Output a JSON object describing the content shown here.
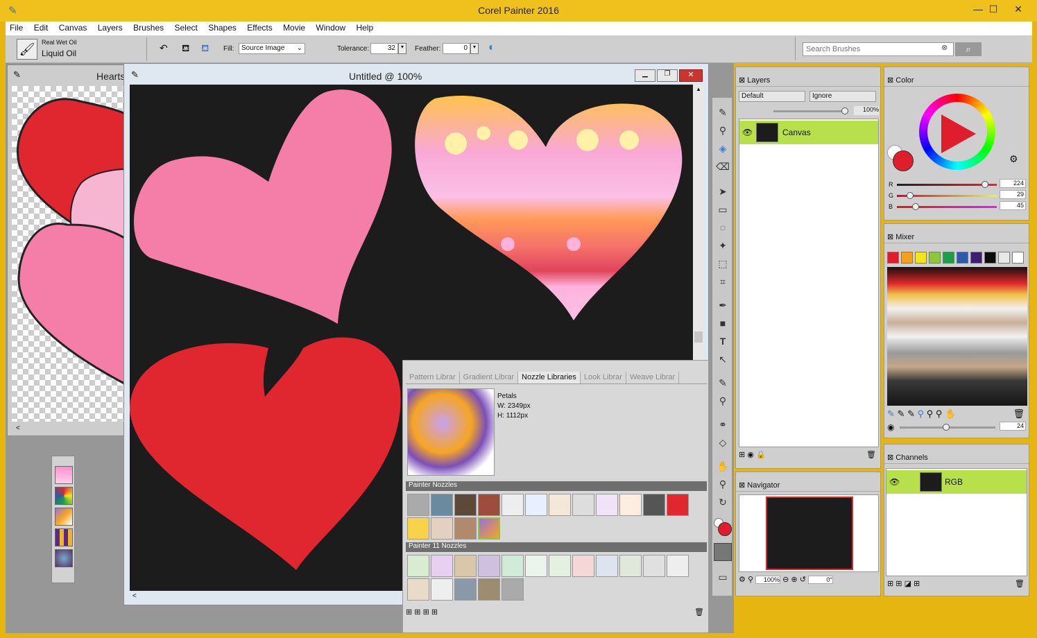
{
  "app": {
    "title": "Corel Painter 2016",
    "min": "—",
    "max": "☐",
    "close": "✕"
  },
  "menu": [
    "File",
    "Edit",
    "Canvas",
    "Layers",
    "Brushes",
    "Select",
    "Shapes",
    "Effects",
    "Movie",
    "Window",
    "Help"
  ],
  "brush": {
    "category": "Real Wet Oil",
    "variant": "Liquid Oil"
  },
  "toolbar": {
    "fill_label": "Fill:",
    "fill_value": "Source Image",
    "tolerance_label": "Tolerance:",
    "tolerance_value": "32",
    "feather_label": "Feather:",
    "feather_value": "0",
    "search_placeholder": "Search Brushes"
  },
  "docs": {
    "back_title": "Hearts",
    "front_title": "Untitled @ 100%"
  },
  "layers": {
    "title": "Layers",
    "composite": "Default",
    "method": "Ignore",
    "opacity": "100%",
    "items": [
      {
        "name": "Canvas"
      }
    ]
  },
  "navigator": {
    "title": "Navigator",
    "zoom": "100%",
    "rotation": "0°"
  },
  "color": {
    "title": "Color",
    "r_label": "R",
    "g_label": "G",
    "b_label": "B",
    "r": "224",
    "g": "29",
    "b": "45",
    "main": "#e01d2d"
  },
  "mixer": {
    "title": "Mixer",
    "brush_size": "24",
    "swatches": [
      "#e01d2d",
      "#f2a11a",
      "#f4e51a",
      "#8dc63f",
      "#1e9e4a",
      "#2e5aa8",
      "#3b2070",
      "#0c0c0c",
      "#e8e8e8",
      "#ffffff"
    ]
  },
  "channels": {
    "title": "Channels",
    "items": [
      {
        "name": "RGB"
      }
    ]
  },
  "libraries": {
    "tabs": [
      "Pattern Librar",
      "Gradient Librar",
      "Nozzle Libraries",
      "Look Librar",
      "Weave Librar"
    ],
    "active_tab": "Nozzle Libraries",
    "selected_name": "Petals",
    "selected_w": "W: 2349px",
    "selected_h": "H: 1112px",
    "group1": "Painter Nozzles",
    "group2": "Painter 11 Nozzles"
  }
}
